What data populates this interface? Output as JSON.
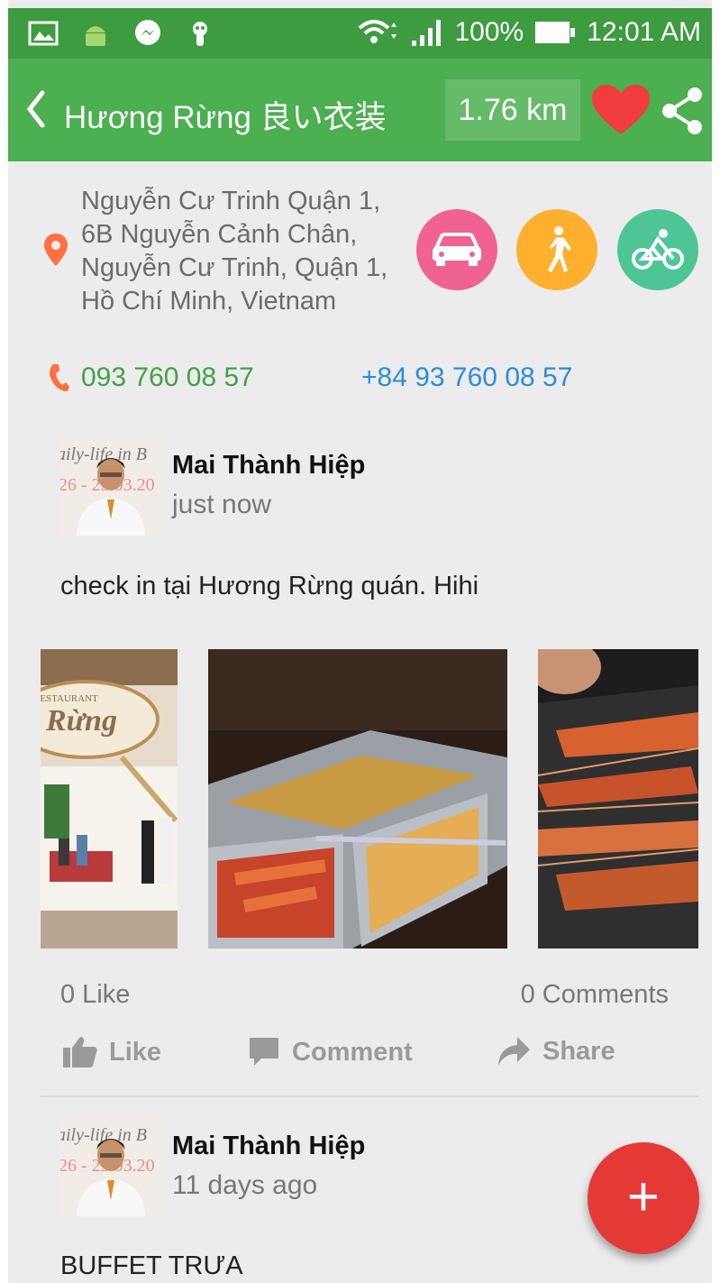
{
  "status_bar": {
    "battery": "100%",
    "time": "12:01 AM"
  },
  "toolbar": {
    "title": "Hương Rừng 良い衣装",
    "distance": "1.76 km"
  },
  "place": {
    "address": "Nguyễn Cư Trinh Quận 1, 6B Nguyễn Cảnh Chân, Nguyễn Cư Trinh, Quận 1, Hồ Chí Minh, Vietnam",
    "phone_local": "093 760 08 57",
    "phone_intl": "+84 93 760 08 57"
  },
  "posts": [
    {
      "author": "Mai Thành Hiệp",
      "time": "just now",
      "text": "check in tại Hương Rừng quán. Hihi",
      "likes": "0 Like",
      "comments": "0 Comments",
      "actions": {
        "like": "Like",
        "comment": "Comment",
        "share": "Share"
      }
    },
    {
      "author": "Mai Thành Hiệp",
      "time": "11 days ago",
      "text": "BUFFET TRƯA"
    }
  ],
  "avatar_text": {
    "line1": "aily-life in B",
    "line2": "26 - 23.03.20"
  },
  "restaurant_sign": {
    "label": "RESTAURANT",
    "name": "Rừng"
  },
  "fab_label": "+",
  "colors": {
    "status_bar": "#3d9b40",
    "toolbar": "#4caf50",
    "car_button": "#f06292",
    "walk_button": "#ffb02e",
    "bike_button": "#4dc596",
    "fab": "#e53935",
    "phone_local": "#43a047",
    "phone_intl": "#2d8cd6"
  }
}
